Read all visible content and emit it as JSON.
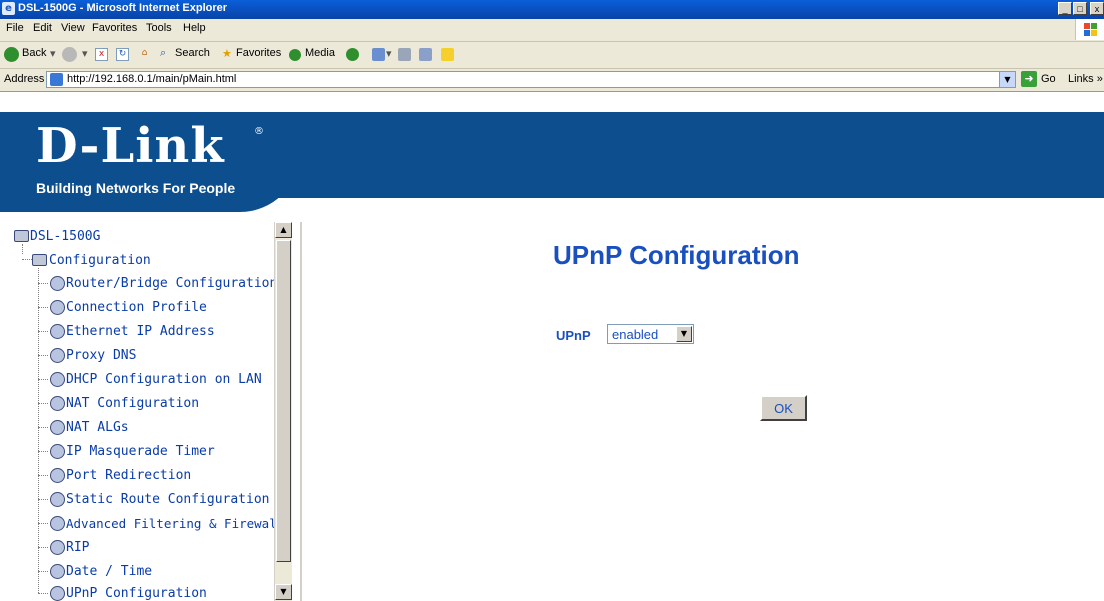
{
  "window": {
    "title": "DSL-1500G - Microsoft Internet Explorer",
    "minimize": "_",
    "maximize": "□",
    "close": "x"
  },
  "menu": [
    "File",
    "Edit",
    "View",
    "Favorites",
    "Tools",
    "Help"
  ],
  "toolbar": {
    "back": "Back",
    "search": "Search",
    "favorites": "Favorites",
    "media": "Media"
  },
  "address": {
    "label": "Address",
    "url": "http://192.168.0.1/main/pMain.html",
    "go": "Go",
    "links": "Links »"
  },
  "banner": {
    "logo": "D-Link",
    "reg": "®",
    "tagline": "Building Networks For People",
    "brand_color": "#0d4e8e"
  },
  "tree": {
    "root": "DSL-1500G",
    "group": "Configuration",
    "items": [
      "Router/Bridge Configuration",
      "Connection Profile",
      "Ethernet IP Address",
      "Proxy DNS",
      "DHCP Configuration on LAN",
      "NAT Configuration",
      "NAT ALGs",
      "IP Masquerade Timer",
      "Port Redirection",
      "Static Route Configuration",
      "Advanced Filtering & Firewall",
      "RIP",
      "Date / Time",
      "UPnP Configuration"
    ]
  },
  "main": {
    "title": "UPnP Configuration",
    "upnp_label": "UPnP",
    "upnp_value": "enabled",
    "ok_label": "OK",
    "accent_color": "#1a4fbf"
  }
}
